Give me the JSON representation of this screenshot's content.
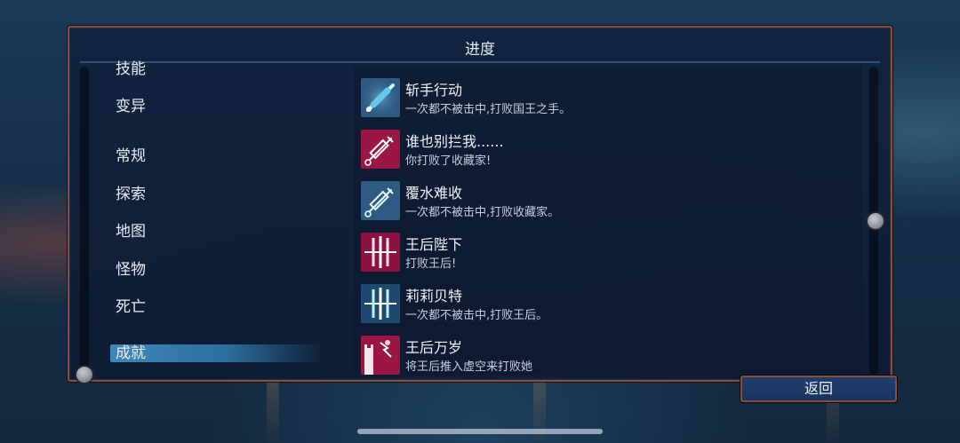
{
  "panel": {
    "title": "进度"
  },
  "categories": [
    {
      "label": "技能",
      "selected": false
    },
    {
      "label": "变异",
      "selected": false
    },
    {
      "label": "常规",
      "selected": false
    },
    {
      "label": "探索",
      "selected": false
    },
    {
      "label": "地图",
      "selected": false
    },
    {
      "label": "怪物",
      "selected": false
    },
    {
      "label": "死亡",
      "selected": false
    },
    {
      "label": "成就",
      "selected": true
    }
  ],
  "achievements": [
    {
      "title": "斩手行动",
      "desc": "一次都不被击中,打败国王之手。",
      "icon": "blue-syringe-icon"
    },
    {
      "title": "谁也别拦我......",
      "desc": "你打败了收藏家!",
      "icon": "pink-syringe-icon"
    },
    {
      "title": "覆水难收",
      "desc": "一次都不被击中,打败收藏家。",
      "icon": "blue-syringe-icon"
    },
    {
      "title": "王后陛下",
      "desc": "打败王后!",
      "icon": "pink-slash-icon"
    },
    {
      "title": "莉莉贝特",
      "desc": "一次都不被击中,打败王后。",
      "icon": "blue-slash-icon"
    },
    {
      "title": "王后万岁",
      "desc": "将王后推入虚空来打败她",
      "icon": "pink-tower-icon"
    }
  ],
  "buttons": {
    "back_label": "返回"
  },
  "colors": {
    "panel_border": "#8a4d3c",
    "selected_highlight": "#3f87b8",
    "pink_accent": "#e8306a",
    "blue_accent": "#6fd4f0"
  }
}
